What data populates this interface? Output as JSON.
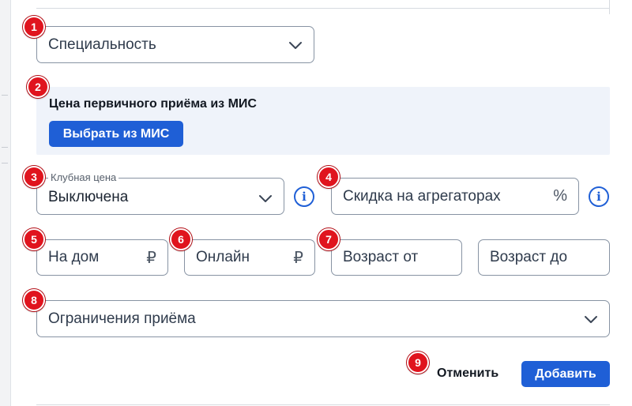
{
  "form": {
    "specialty": {
      "placeholder": "Специальность",
      "icon": "chevron-down-icon"
    },
    "price_panel": {
      "title": "Цена первичного приёма из МИС",
      "button_label": "Выбрать из МИС"
    },
    "club_price": {
      "label": "Клубная цена",
      "value": "Выключена",
      "icon": "chevron-down-icon",
      "info_icon": "info-icon"
    },
    "aggregator_discount": {
      "placeholder": "Скидка на агрегаторах",
      "suffix": "%",
      "info_icon": "info-icon"
    },
    "home_price": {
      "placeholder": "На дом",
      "suffix": "₽"
    },
    "online_price": {
      "placeholder": "Онлайн",
      "suffix": "₽"
    },
    "age_from": {
      "placeholder": "Возраст от"
    },
    "age_to": {
      "placeholder": "Возраст до"
    },
    "restrictions": {
      "placeholder": "Ограничения приёма",
      "icon": "chevron-down-icon"
    },
    "actions": {
      "cancel_label": "Отменить",
      "submit_label": "Добавить"
    }
  },
  "annotations": [
    "1",
    "2",
    "3",
    "4",
    "5",
    "6",
    "7",
    "8",
    "9"
  ],
  "colors": {
    "accent": "#1f5fd6",
    "marker": "#e0141e",
    "panel_bg": "#eff3fa",
    "border": "#8793a3"
  }
}
